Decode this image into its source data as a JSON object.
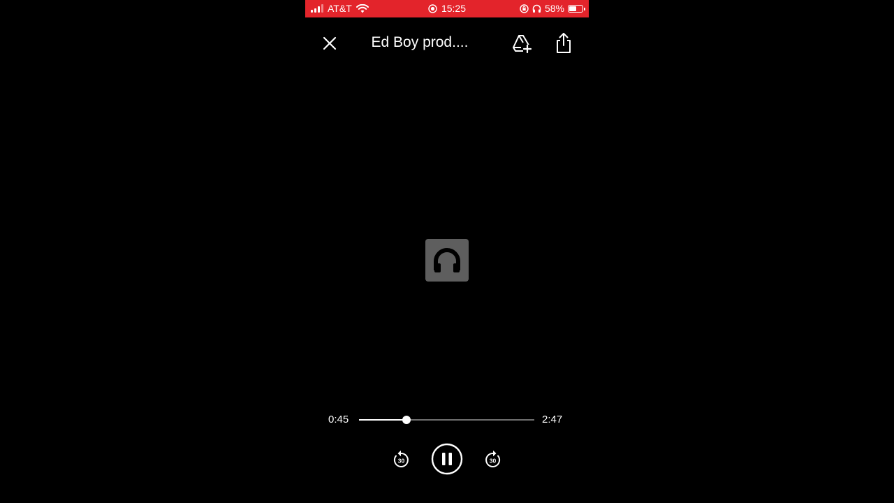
{
  "status_bar": {
    "carrier": "AT&T",
    "time": "15:25",
    "battery_percent": "58%",
    "battery_level": 0.58,
    "icons": [
      "signal-icon",
      "wifi-icon",
      "screen-recording-icon",
      "orientation-lock-icon",
      "headphones-icon",
      "battery-icon"
    ]
  },
  "top_bar": {
    "title": "Ed Boy prod....",
    "icons": [
      "close-icon",
      "add-to-drive-icon",
      "share-icon"
    ]
  },
  "artwork": {
    "icon": "headphones-icon"
  },
  "player": {
    "current_time": "0:45",
    "total_time": "2:47",
    "progress_fraction": 0.27,
    "rewind_seconds": "30",
    "forward_seconds": "30",
    "state_icon": "pause-icon"
  },
  "colors": {
    "status_bar_bg": "#e3242b",
    "background": "#000000",
    "artwork_bg": "#5e5e5e",
    "track_bg": "#6f6f6f",
    "accent": "#ffffff"
  }
}
